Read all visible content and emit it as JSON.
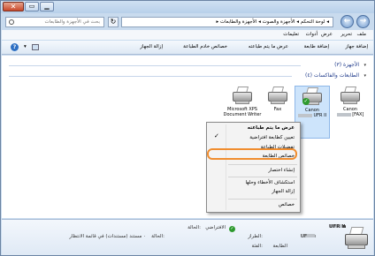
{
  "window": {
    "close_glyph": "✕",
    "max_glyph": "▭",
    "min_glyph": "▁"
  },
  "address": {
    "path": "▸ لوحة التحكم ◂ الأجهزة والصوت ◂ الأجهزة والطابعات ◂",
    "search_placeholder": "بحث في الأجهزة والطابعات",
    "back_glyph": "→",
    "forward_glyph": "←",
    "refresh_glyph": "↻"
  },
  "menubar": {
    "file": "ملف",
    "edit": "تحرير",
    "view": "عرض",
    "tools": "أدوات",
    "help": "تعليمات"
  },
  "toolbar": {
    "add_device": "إضافة جهاز",
    "add_printer": "إضافة طابعة",
    "see_whats_printing": "عرض ما يتم طباعته",
    "print_server_props": "خصائص خادم الطباعة",
    "remove_device": "إزالة الجهاز",
    "help_glyph": "?",
    "view_arrow": "▾"
  },
  "content": {
    "devices_header": "الأجهزة (٣)",
    "printers_header": "الطابعات والفاكسات (٤)",
    "collapse_glyph": "▾",
    "devices": [
      {
        "label1": "Canon",
        "label2": "[FAX]"
      },
      {
        "label1": "Canon",
        "label2": "UFR II"
      },
      {
        "label1": "Fax",
        "label2": ""
      },
      {
        "label1": "Microsoft XPS",
        "label2": "Document Writer"
      }
    ],
    "check_glyph": "✓"
  },
  "context_menu": {
    "see_whats_printing": "عرض ما يتم طباعته",
    "set_default": "تعيين كطابعة افتراضية",
    "printing_preferences": "تفضيلات الطباعة",
    "printer_properties": "خصائص الطابعة",
    "create_shortcut": "إنشاء اختصار",
    "troubleshoot": "استكشاف الأخطاء وحلها",
    "remove_device": "إزالة الجهاز",
    "properties": "خصائص",
    "tick": "✓"
  },
  "details": {
    "name_prefix": "Canon",
    "name_suffix": "UFR II",
    "state_label": "الحالة:",
    "state_value": "الافتراضي",
    "status_label": "الحالة:",
    "status_value": "٠ مستند (مستندات) في قائمة الانتظار",
    "model_label": "الطراز:",
    "model_value": "Canon",
    "model_suffix": "UF",
    "category_label": "الفئة:",
    "category_value": "الطابعة"
  }
}
